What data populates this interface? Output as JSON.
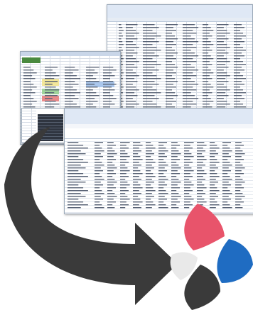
{
  "shots": {
    "top_right": {
      "caption": "spreadsheet-screenshot-1"
    },
    "middle_left": {
      "caption": "spreadsheet-screenshot-2"
    },
    "bottom": {
      "caption": "spreadsheet-screenshot-3"
    }
  },
  "icons": {
    "arrow": "curved-arrow-icon",
    "logo": "four-petal-logo-icon"
  },
  "colors": {
    "arrow": "#3a3a3a",
    "petal_red": "#e8546b",
    "petal_blue": "#1f6cc2",
    "petal_dark": "#3a3a3a",
    "petal_light": "#e9e9e9",
    "sheet_header": "#dfe8f5",
    "sheet_green": "#3f7d3a"
  }
}
